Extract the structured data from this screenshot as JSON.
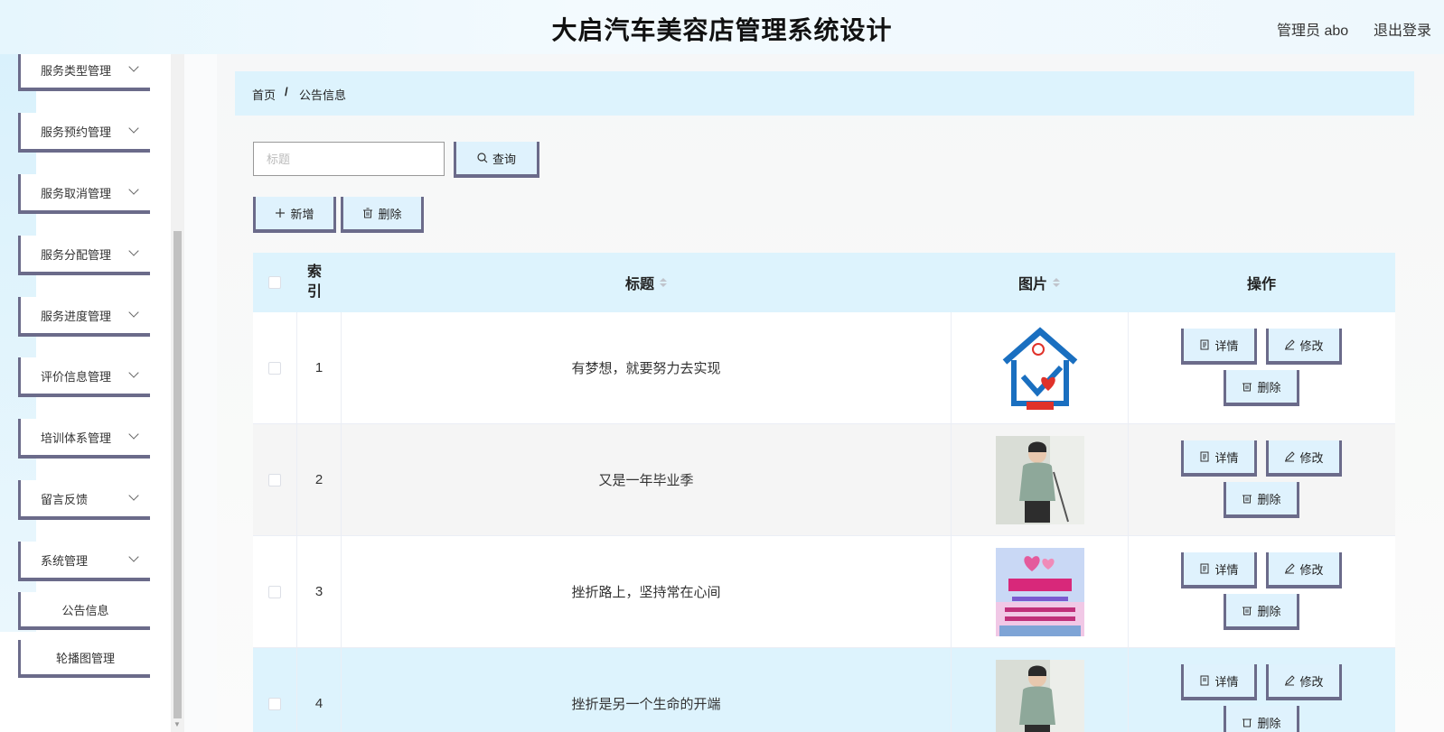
{
  "header": {
    "title": "大启汽车美容店管理系统设计",
    "admin": "管理员 abo",
    "logout": "退出登录"
  },
  "sidebar": {
    "items": [
      {
        "label": "服务类型管理"
      },
      {
        "label": "服务预约管理"
      },
      {
        "label": "服务取消管理"
      },
      {
        "label": "服务分配管理"
      },
      {
        "label": "服务进度管理"
      },
      {
        "label": "评价信息管理"
      },
      {
        "label": "培训体系管理"
      },
      {
        "label": "留言反馈"
      },
      {
        "label": "系统管理"
      }
    ],
    "subitems": [
      {
        "label": "公告信息"
      },
      {
        "label": "轮播图管理"
      }
    ]
  },
  "breadcrumb": {
    "home": "首页",
    "sep": "/",
    "current": "公告信息"
  },
  "search": {
    "placeholder": "标题",
    "button": "查询"
  },
  "toolbar": {
    "add": "新增",
    "delete": "删除"
  },
  "table": {
    "headers": {
      "index": "索引",
      "title": "标题",
      "image": "图片",
      "ops": "操作"
    },
    "rows": [
      {
        "index": "1",
        "title": "有梦想，就要努力去实现",
        "image": "logo"
      },
      {
        "index": "2",
        "title": "又是一年毕业季",
        "image": "person"
      },
      {
        "index": "3",
        "title": "挫折路上，坚持常在心间",
        "image": "poster"
      },
      {
        "index": "4",
        "title": "挫折是另一个生命的开端",
        "image": "person"
      }
    ],
    "actions": {
      "detail": "详情",
      "edit": "修改",
      "delete": "删除"
    }
  },
  "colors": {
    "accent": "#ddf3fd",
    "border": "#6b6b8a",
    "row_alt": "#f5f5f5",
    "row_highlight": "#ddf3fd"
  }
}
